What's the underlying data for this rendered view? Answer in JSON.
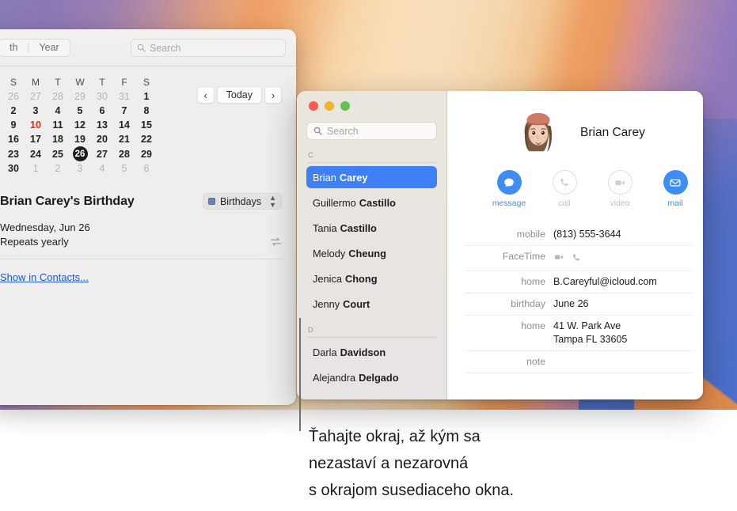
{
  "calendar": {
    "toolbar": {
      "segments": [
        "th",
        "Year"
      ],
      "search_placeholder": "Search"
    },
    "nav": {
      "prev_label": "‹",
      "today_label": "Today",
      "next_label": "›"
    },
    "weekday_headers": [
      "S",
      "M",
      "T",
      "W",
      "T",
      "F",
      "S"
    ],
    "weeks": [
      [
        {
          "d": "26",
          "state": "dim"
        },
        {
          "d": "27",
          "state": "dim"
        },
        {
          "d": "28",
          "state": "dim"
        },
        {
          "d": "29",
          "state": "dim"
        },
        {
          "d": "30",
          "state": "dim"
        },
        {
          "d": "31",
          "state": "dim"
        },
        {
          "d": "1",
          "state": "normal"
        }
      ],
      [
        {
          "d": "2",
          "state": "normal"
        },
        {
          "d": "3",
          "state": "normal"
        },
        {
          "d": "4",
          "state": "normal"
        },
        {
          "d": "5",
          "state": "normal"
        },
        {
          "d": "6",
          "state": "normal"
        },
        {
          "d": "7",
          "state": "normal"
        },
        {
          "d": "8",
          "state": "normal"
        }
      ],
      [
        {
          "d": "9",
          "state": "normal"
        },
        {
          "d": "10",
          "state": "today"
        },
        {
          "d": "11",
          "state": "normal"
        },
        {
          "d": "12",
          "state": "normal"
        },
        {
          "d": "13",
          "state": "normal"
        },
        {
          "d": "14",
          "state": "normal"
        },
        {
          "d": "15",
          "state": "normal"
        }
      ],
      [
        {
          "d": "16",
          "state": "normal"
        },
        {
          "d": "17",
          "state": "normal"
        },
        {
          "d": "18",
          "state": "normal"
        },
        {
          "d": "19",
          "state": "normal"
        },
        {
          "d": "20",
          "state": "normal"
        },
        {
          "d": "21",
          "state": "normal"
        },
        {
          "d": "22",
          "state": "normal"
        }
      ],
      [
        {
          "d": "23",
          "state": "normal"
        },
        {
          "d": "24",
          "state": "normal"
        },
        {
          "d": "25",
          "state": "normal"
        },
        {
          "d": "26",
          "state": "selected"
        },
        {
          "d": "27",
          "state": "normal"
        },
        {
          "d": "28",
          "state": "normal"
        },
        {
          "d": "29",
          "state": "normal"
        }
      ],
      [
        {
          "d": "30",
          "state": "normal"
        },
        {
          "d": "1",
          "state": "dim"
        },
        {
          "d": "2",
          "state": "dim"
        },
        {
          "d": "3",
          "state": "dim"
        },
        {
          "d": "4",
          "state": "dim"
        },
        {
          "d": "5",
          "state": "dim"
        },
        {
          "d": "6",
          "state": "dim"
        }
      ]
    ],
    "event": {
      "title": "Brian Carey's Birthday",
      "calendar_picker": "Birthdays",
      "calendar_color": "#6e81ad",
      "date": "Wednesday, Jun 26",
      "repeat": "Repeats yearly",
      "repeat_icon": "repeat-icon",
      "show_in_contacts": "Show in Contacts..."
    }
  },
  "contacts": {
    "search_placeholder": "Search",
    "groups": [
      {
        "letter": "C",
        "people": [
          {
            "first": "Brian",
            "last": "Carey",
            "selected": true
          },
          {
            "first": "Guillermo",
            "last": "Castillo",
            "selected": false
          },
          {
            "first": "Tania",
            "last": "Castillo",
            "selected": false
          },
          {
            "first": "Melody",
            "last": "Cheung",
            "selected": false
          },
          {
            "first": "Jenica",
            "last": "Chong",
            "selected": false
          },
          {
            "first": "Jenny",
            "last": "Court",
            "selected": false
          }
        ]
      },
      {
        "letter": "D",
        "people": [
          {
            "first": "Darla",
            "last": "Davidson",
            "selected": false
          },
          {
            "first": "Alejandra",
            "last": "Delgado",
            "selected": false
          }
        ]
      }
    ],
    "detail": {
      "name": "Brian Carey",
      "avatar": "memoji-avatar",
      "actions": [
        {
          "label": "message",
          "icon": "message-bubble-icon",
          "enabled": true
        },
        {
          "label": "call",
          "icon": "phone-handset-icon",
          "enabled": false
        },
        {
          "label": "video",
          "icon": "video-camera-icon",
          "enabled": false
        },
        {
          "label": "mail",
          "icon": "envelope-icon",
          "enabled": true
        }
      ],
      "fields": [
        {
          "label": "mobile",
          "value": "(813) 555-3644",
          "type": "text"
        },
        {
          "label": "FaceTime",
          "value": "",
          "type": "icons"
        },
        {
          "label": "home",
          "value": "B.Careyful@icloud.com",
          "type": "text"
        },
        {
          "label": "birthday",
          "value": "June 26",
          "type": "text"
        },
        {
          "label": "home",
          "value": "41 W. Park Ave",
          "value2": "Tampa FL 33605",
          "type": "text2"
        },
        {
          "label": "note",
          "value": "",
          "type": "text"
        }
      ]
    }
  },
  "caption": {
    "line1": "Ťahajte okraj, až kým sa",
    "line2": "nezastaví a nezarovná",
    "line3": "s okrajom susediaceho okna."
  },
  "colors": {
    "accent_blue": "#3f8df3",
    "selection_blue": "#3f7ff5",
    "link_blue": "#1d57c8",
    "today_red": "#e02d17"
  }
}
